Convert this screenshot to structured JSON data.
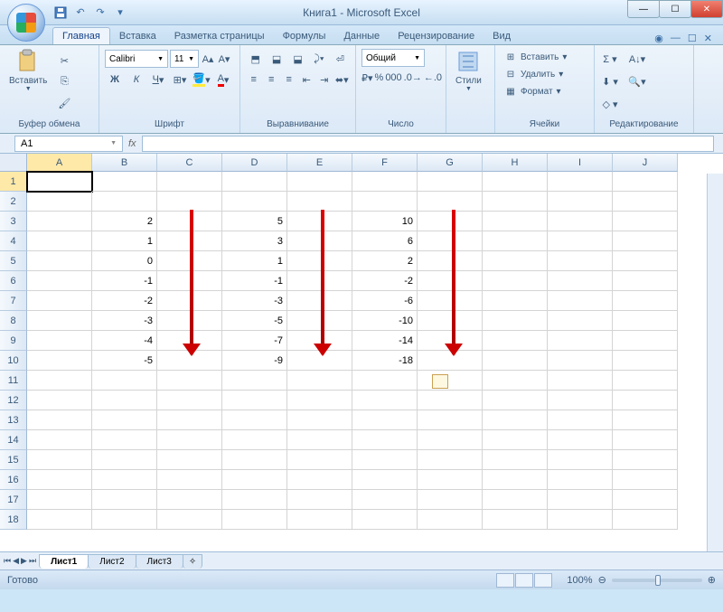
{
  "title": "Книга1 - Microsoft Excel",
  "tabs": {
    "home": "Главная",
    "insert": "Вставка",
    "pagelayout": "Разметка страницы",
    "formulas": "Формулы",
    "data": "Данные",
    "review": "Рецензирование",
    "view": "Вид"
  },
  "ribbon": {
    "clipboard": {
      "paste": "Вставить",
      "group": "Буфер обмена"
    },
    "font": {
      "name": "Calibri",
      "size": "11",
      "group": "Шрифт"
    },
    "align": {
      "group": "Выравнивание"
    },
    "number": {
      "format": "Общий",
      "group": "Число"
    },
    "styles": {
      "btn": "Стили"
    },
    "cells": {
      "insert": "Вставить",
      "delete": "Удалить",
      "format": "Формат",
      "group": "Ячейки"
    },
    "editing": {
      "group": "Редактирование"
    }
  },
  "namebox": "A1",
  "columns": [
    "A",
    "B",
    "C",
    "D",
    "E",
    "F",
    "G",
    "H",
    "I",
    "J"
  ],
  "rows": [
    "1",
    "2",
    "3",
    "4",
    "5",
    "6",
    "7",
    "8",
    "9",
    "10",
    "11",
    "12",
    "13",
    "14",
    "15",
    "16",
    "17",
    "18"
  ],
  "cell_data": {
    "3": {
      "B": "2",
      "D": "5",
      "F": "10"
    },
    "4": {
      "B": "1",
      "D": "3",
      "F": "6"
    },
    "5": {
      "B": "0",
      "D": "1",
      "F": "2"
    },
    "6": {
      "B": "-1",
      "D": "-1",
      "F": "-2"
    },
    "7": {
      "B": "-2",
      "D": "-3",
      "F": "-6"
    },
    "8": {
      "B": "-3",
      "D": "-5",
      "F": "-10"
    },
    "9": {
      "B": "-4",
      "D": "-7",
      "F": "-14"
    },
    "10": {
      "B": "-5",
      "D": "-9",
      "F": "-18"
    }
  },
  "sheets": {
    "s1": "Лист1",
    "s2": "Лист2",
    "s3": "Лист3"
  },
  "status": "Готово",
  "zoom": "100%",
  "chart_data": {
    "type": "table",
    "series": [
      {
        "name": "B",
        "values": [
          2,
          1,
          0,
          -1,
          -2,
          -3,
          -4,
          -5
        ]
      },
      {
        "name": "D",
        "values": [
          5,
          3,
          1,
          -1,
          -3,
          -5,
          -7,
          -9
        ]
      },
      {
        "name": "F",
        "values": [
          10,
          6,
          2,
          -2,
          -6,
          -10,
          -14,
          -18
        ]
      }
    ],
    "row_start": 3
  }
}
